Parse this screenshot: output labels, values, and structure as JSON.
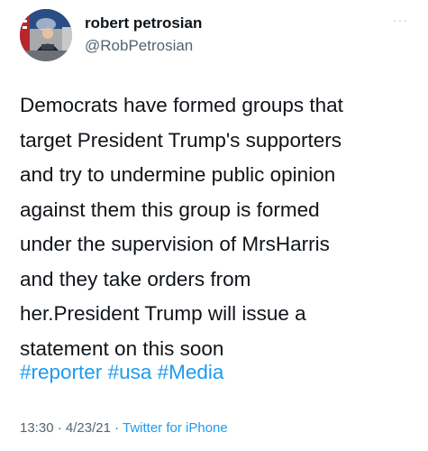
{
  "user": {
    "display_name": "robert petrosian",
    "handle": "@RobPetrosian"
  },
  "more_label": "···",
  "tweet": {
    "lines": [
      "Democrats have formed groups that",
      "target President Trump's supporters",
      "and try to undermine public opinion",
      "against them this group is formed",
      "under the supervision of MrsHarris",
      "and they take orders from",
      "her.President Trump will issue a",
      "statement on this soon"
    ],
    "hashtags": [
      "#reporter",
      "#usa",
      "#Media"
    ]
  },
  "meta": {
    "time": "13:30",
    "separator": " · ",
    "date": "4/23/21",
    "source": "Twitter for iPhone"
  },
  "colors": {
    "link": "#1d9bf0",
    "secondary": "#536471",
    "text": "#0f1419"
  }
}
